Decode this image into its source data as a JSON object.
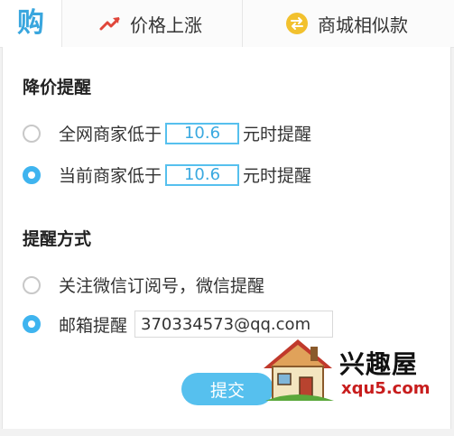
{
  "tabs": {
    "logo_glyph": "购",
    "rise_label": "价格上涨",
    "similar_label": "商城相似款"
  },
  "price_alert": {
    "title": "降价提醒",
    "options": [
      {
        "prefix": "全网商家低于",
        "value": "10.6",
        "suffix": "元时提醒",
        "checked": false
      },
      {
        "prefix": "当前商家低于",
        "value": "10.6",
        "suffix": "元时提醒",
        "checked": true
      }
    ]
  },
  "method": {
    "title": "提醒方式",
    "wechat_label": "关注微信订阅号，微信提醒",
    "email_label": "邮箱提醒",
    "email_value": "370334573@qq.com"
  },
  "submit_label": "提交",
  "watermark": {
    "cn": "兴趣屋",
    "url": "xqu5.com"
  },
  "colors": {
    "accent": "#3fb4ef",
    "rise": "#e0463a",
    "similar": "#f2c12e"
  }
}
